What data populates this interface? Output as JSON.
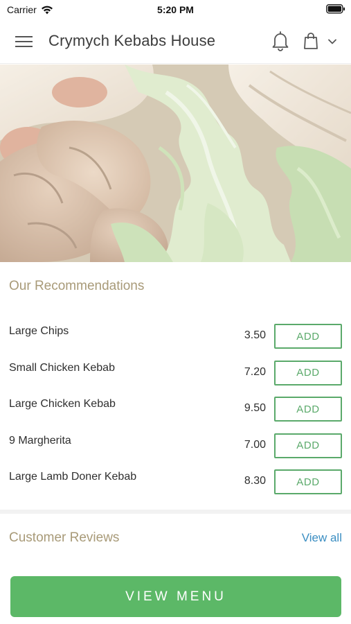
{
  "status_bar": {
    "carrier": "Carrier",
    "time": "5:20 PM"
  },
  "header": {
    "title": "Crymych Kebabs House",
    "icons": [
      "menu-icon",
      "bell-icon",
      "shopping-bag-icon",
      "chevron-down-icon"
    ]
  },
  "recommendations": {
    "title": "Our Recommendations",
    "add_label": "ADD",
    "items": [
      {
        "name": "Large Chips",
        "price": "3.50"
      },
      {
        "name": "Small Chicken Kebab",
        "price": "7.20"
      },
      {
        "name": "Large Chicken Kebab",
        "price": "9.50"
      },
      {
        "name": "9 Margherita",
        "price": "7.00"
      },
      {
        "name": "Large Lamb Doner Kebab",
        "price": "8.30"
      }
    ]
  },
  "reviews": {
    "title": "Customer Reviews",
    "view_all": "View all"
  },
  "footer": {
    "view_menu": "VIEW MENU"
  },
  "colors": {
    "accent_green": "#5cb867",
    "section_title": "#a89a78",
    "link_blue": "#3b8ec2"
  }
}
